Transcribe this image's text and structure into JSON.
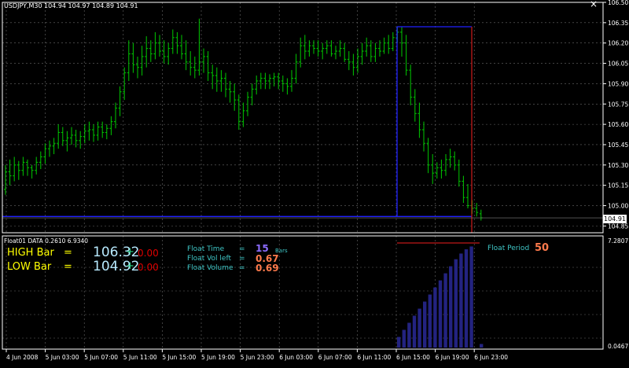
{
  "chart_title": "USDJPY,M30",
  "ohlc_readout": "104.94 104.97 104.89 104.91",
  "current_price": "104.91",
  "colors": {
    "background": "#000000",
    "candle": "#00c800",
    "grid": "#6a6a6a",
    "axis_text": "#ffffff",
    "box": "#2020ff",
    "red_line": "#c01818",
    "histogram": "#232380",
    "label_cyan": "#3fc7c7",
    "value_orange": "#ff7a4c",
    "value_purple": "#8c6cff",
    "high_low_yellow": "#ffff00",
    "high_low_value": "#b8eaff",
    "red_value": "#e00000",
    "plus_green": "#2bd38a"
  },
  "price_axis": {
    "labels": [
      "106.50",
      "106.35",
      "106.20",
      "106.05",
      "105.90",
      "105.75",
      "105.60",
      "105.45",
      "105.30",
      "105.15",
      "105.00",
      "104.85"
    ]
  },
  "time_axis": {
    "labels": [
      "4 Jun 2008",
      "5 Jun 03:00",
      "5 Jun 07:00",
      "5 Jun 11:00",
      "5 Jun 15:00",
      "5 Jun 19:00",
      "5 Jun 23:00",
      "6 Jun 03:00",
      "6 Jun 07:00",
      "6 Jun 11:00",
      "6 Jun 15:00",
      "6 Jun 19:00",
      "6 Jun 23:00"
    ]
  },
  "indicator": {
    "title": "Float01 DATA 0.2610 6.9340",
    "axis_top": "7.2807",
    "axis_bottom": "0.0467",
    "high_label": "HIGH Bar",
    "high_eq": "=",
    "high_value": "106.32",
    "high_plus": "+",
    "high_delta": "0.00",
    "low_label": "LOW Bar",
    "low_eq": "=",
    "low_value": "104.92",
    "low_plus": "+",
    "low_delta": "0.00",
    "float_time_label": "Float Time",
    "float_time_eq": "=",
    "float_time_value": "15",
    "float_time_unit": "Bars",
    "float_vol_left_label": "Float Vol left",
    "float_vol_left_eq": "=",
    "float_vol_left_value": "0.67",
    "float_volume_label": "Float Volume",
    "float_volume_eq": "=",
    "float_volume_value": "0.69",
    "float_period_label": "Float Period",
    "float_period_value": "50"
  },
  "chart_data": {
    "type": "candlestick",
    "symbol": "USDJPY",
    "timeframe": "M30",
    "ylim": [
      104.8,
      106.5
    ],
    "box": {
      "high": 106.32,
      "low": 104.92
    },
    "candles": [
      {
        "o": 105.12,
        "h": 105.3,
        "l": 105.08,
        "c": 105.25
      },
      {
        "o": 105.25,
        "h": 105.34,
        "l": 105.15,
        "c": 105.22
      },
      {
        "o": 105.22,
        "h": 105.36,
        "l": 105.18,
        "c": 105.3
      },
      {
        "o": 105.3,
        "h": 105.33,
        "l": 105.19,
        "c": 105.26
      },
      {
        "o": 105.26,
        "h": 105.36,
        "l": 105.22,
        "c": 105.32
      },
      {
        "o": 105.32,
        "h": 105.34,
        "l": 105.22,
        "c": 105.28
      },
      {
        "o": 105.28,
        "h": 105.3,
        "l": 105.2,
        "c": 105.26
      },
      {
        "o": 105.26,
        "h": 105.36,
        "l": 105.23,
        "c": 105.32
      },
      {
        "o": 105.32,
        "h": 105.4,
        "l": 105.27,
        "c": 105.36
      },
      {
        "o": 105.36,
        "h": 105.46,
        "l": 105.31,
        "c": 105.42
      },
      {
        "o": 105.42,
        "h": 105.48,
        "l": 105.36,
        "c": 105.44
      },
      {
        "o": 105.44,
        "h": 105.5,
        "l": 105.38,
        "c": 105.46
      },
      {
        "o": 105.46,
        "h": 105.6,
        "l": 105.42,
        "c": 105.54
      },
      {
        "o": 105.54,
        "h": 105.58,
        "l": 105.44,
        "c": 105.48
      },
      {
        "o": 105.48,
        "h": 105.55,
        "l": 105.4,
        "c": 105.5
      },
      {
        "o": 105.5,
        "h": 105.58,
        "l": 105.45,
        "c": 105.52
      },
      {
        "o": 105.52,
        "h": 105.56,
        "l": 105.43,
        "c": 105.48
      },
      {
        "o": 105.48,
        "h": 105.55,
        "l": 105.42,
        "c": 105.51
      },
      {
        "o": 105.51,
        "h": 105.6,
        "l": 105.46,
        "c": 105.55
      },
      {
        "o": 105.55,
        "h": 105.62,
        "l": 105.48,
        "c": 105.56
      },
      {
        "o": 105.56,
        "h": 105.6,
        "l": 105.47,
        "c": 105.52
      },
      {
        "o": 105.52,
        "h": 105.62,
        "l": 105.48,
        "c": 105.58
      },
      {
        "o": 105.58,
        "h": 105.62,
        "l": 105.5,
        "c": 105.54
      },
      {
        "o": 105.54,
        "h": 105.6,
        "l": 105.49,
        "c": 105.57
      },
      {
        "o": 105.57,
        "h": 105.66,
        "l": 105.52,
        "c": 105.62
      },
      {
        "o": 105.62,
        "h": 105.76,
        "l": 105.57,
        "c": 105.72
      },
      {
        "o": 105.72,
        "h": 105.88,
        "l": 105.66,
        "c": 105.84
      },
      {
        "o": 105.84,
        "h": 106.02,
        "l": 105.78,
        "c": 105.98
      },
      {
        "o": 105.98,
        "h": 106.22,
        "l": 105.92,
        "c": 106.12
      },
      {
        "o": 106.12,
        "h": 106.2,
        "l": 105.98,
        "c": 106.04
      },
      {
        "o": 106.04,
        "h": 106.1,
        "l": 105.94,
        "c": 106.02
      },
      {
        "o": 106.02,
        "h": 106.18,
        "l": 105.96,
        "c": 106.1
      },
      {
        "o": 106.1,
        "h": 106.25,
        "l": 106.02,
        "c": 106.16
      },
      {
        "o": 106.16,
        "h": 106.22,
        "l": 106.06,
        "c": 106.12
      },
      {
        "o": 106.12,
        "h": 106.28,
        "l": 106.08,
        "c": 106.2
      },
      {
        "o": 106.2,
        "h": 106.26,
        "l": 106.1,
        "c": 106.14
      },
      {
        "o": 106.14,
        "h": 106.22,
        "l": 106.05,
        "c": 106.1
      },
      {
        "o": 106.1,
        "h": 106.2,
        "l": 106.04,
        "c": 106.16
      },
      {
        "o": 106.16,
        "h": 106.3,
        "l": 106.12,
        "c": 106.24
      },
      {
        "o": 106.24,
        "h": 106.28,
        "l": 106.12,
        "c": 106.18
      },
      {
        "o": 106.18,
        "h": 106.26,
        "l": 106.08,
        "c": 106.12
      },
      {
        "o": 106.12,
        "h": 106.22,
        "l": 106.0,
        "c": 106.06
      },
      {
        "o": 106.06,
        "h": 106.14,
        "l": 105.96,
        "c": 106.02
      },
      {
        "o": 106.02,
        "h": 106.1,
        "l": 105.94,
        "c": 106.0
      },
      {
        "o": 106.0,
        "h": 106.38,
        "l": 105.96,
        "c": 106.06
      },
      {
        "o": 106.06,
        "h": 106.16,
        "l": 105.98,
        "c": 106.1
      },
      {
        "o": 106.1,
        "h": 106.14,
        "l": 105.92,
        "c": 105.98
      },
      {
        "o": 105.98,
        "h": 106.04,
        "l": 105.86,
        "c": 105.96
      },
      {
        "o": 105.96,
        "h": 106.02,
        "l": 105.84,
        "c": 105.92
      },
      {
        "o": 105.92,
        "h": 106.0,
        "l": 105.84,
        "c": 105.94
      },
      {
        "o": 105.94,
        "h": 105.98,
        "l": 105.8,
        "c": 105.86
      },
      {
        "o": 105.86,
        "h": 105.92,
        "l": 105.76,
        "c": 105.84
      },
      {
        "o": 105.84,
        "h": 105.9,
        "l": 105.7,
        "c": 105.78
      },
      {
        "o": 105.78,
        "h": 105.82,
        "l": 105.56,
        "c": 105.62
      },
      {
        "o": 105.62,
        "h": 105.76,
        "l": 105.58,
        "c": 105.7
      },
      {
        "o": 105.7,
        "h": 105.84,
        "l": 105.66,
        "c": 105.8
      },
      {
        "o": 105.8,
        "h": 105.9,
        "l": 105.74,
        "c": 105.86
      },
      {
        "o": 105.86,
        "h": 105.96,
        "l": 105.82,
        "c": 105.92
      },
      {
        "o": 105.92,
        "h": 105.98,
        "l": 105.86,
        "c": 105.94
      },
      {
        "o": 105.94,
        "h": 105.98,
        "l": 105.86,
        "c": 105.92
      },
      {
        "o": 105.92,
        "h": 105.97,
        "l": 105.86,
        "c": 105.94
      },
      {
        "o": 105.94,
        "h": 105.98,
        "l": 105.88,
        "c": 105.95
      },
      {
        "o": 105.95,
        "h": 105.98,
        "l": 105.86,
        "c": 105.92
      },
      {
        "o": 105.92,
        "h": 105.96,
        "l": 105.84,
        "c": 105.9
      },
      {
        "o": 105.9,
        "h": 105.94,
        "l": 105.82,
        "c": 105.88
      },
      {
        "o": 105.88,
        "h": 106.0,
        "l": 105.84,
        "c": 105.94
      },
      {
        "o": 105.94,
        "h": 106.12,
        "l": 105.9,
        "c": 106.06
      },
      {
        "o": 106.06,
        "h": 106.24,
        "l": 106.02,
        "c": 106.18
      },
      {
        "o": 106.18,
        "h": 106.26,
        "l": 106.08,
        "c": 106.14
      },
      {
        "o": 106.14,
        "h": 106.22,
        "l": 106.1,
        "c": 106.18
      },
      {
        "o": 106.18,
        "h": 106.22,
        "l": 106.12,
        "c": 106.16
      },
      {
        "o": 106.16,
        "h": 106.22,
        "l": 106.1,
        "c": 106.14
      },
      {
        "o": 106.14,
        "h": 106.2,
        "l": 106.08,
        "c": 106.16
      },
      {
        "o": 106.16,
        "h": 106.22,
        "l": 106.12,
        "c": 106.18
      },
      {
        "o": 106.18,
        "h": 106.22,
        "l": 106.1,
        "c": 106.12
      },
      {
        "o": 106.12,
        "h": 106.18,
        "l": 106.08,
        "c": 106.14
      },
      {
        "o": 106.14,
        "h": 106.22,
        "l": 106.1,
        "c": 106.16
      },
      {
        "o": 106.16,
        "h": 106.2,
        "l": 106.06,
        "c": 106.08
      },
      {
        "o": 106.08,
        "h": 106.14,
        "l": 106.0,
        "c": 106.06
      },
      {
        "o": 106.06,
        "h": 106.12,
        "l": 105.96,
        "c": 106.02
      },
      {
        "o": 106.02,
        "h": 106.16,
        "l": 105.98,
        "c": 106.1
      },
      {
        "o": 106.1,
        "h": 106.2,
        "l": 106.04,
        "c": 106.14
      },
      {
        "o": 106.14,
        "h": 106.24,
        "l": 106.1,
        "c": 106.18
      },
      {
        "o": 106.18,
        "h": 106.22,
        "l": 106.06,
        "c": 106.1
      },
      {
        "o": 106.1,
        "h": 106.2,
        "l": 106.06,
        "c": 106.16
      },
      {
        "o": 106.16,
        "h": 106.22,
        "l": 106.1,
        "c": 106.14
      },
      {
        "o": 106.14,
        "h": 106.24,
        "l": 106.12,
        "c": 106.2
      },
      {
        "o": 106.2,
        "h": 106.26,
        "l": 106.12,
        "c": 106.16
      },
      {
        "o": 106.16,
        "h": 106.28,
        "l": 106.14,
        "c": 106.24
      },
      {
        "o": 106.24,
        "h": 106.32,
        "l": 106.2,
        "c": 106.28
      },
      {
        "o": 106.28,
        "h": 106.32,
        "l": 106.1,
        "c": 106.2
      },
      {
        "o": 106.2,
        "h": 106.26,
        "l": 105.96,
        "c": 106.0
      },
      {
        "o": 106.0,
        "h": 106.04,
        "l": 105.74,
        "c": 105.8
      },
      {
        "o": 105.8,
        "h": 105.86,
        "l": 105.62,
        "c": 105.68
      },
      {
        "o": 105.68,
        "h": 105.76,
        "l": 105.5,
        "c": 105.56
      },
      {
        "o": 105.56,
        "h": 105.62,
        "l": 105.4,
        "c": 105.46
      },
      {
        "o": 105.46,
        "h": 105.5,
        "l": 105.24,
        "c": 105.3
      },
      {
        "o": 105.3,
        "h": 105.38,
        "l": 105.16,
        "c": 105.24
      },
      {
        "o": 105.24,
        "h": 105.32,
        "l": 105.2,
        "c": 105.28
      },
      {
        "o": 105.28,
        "h": 105.34,
        "l": 105.2,
        "c": 105.26
      },
      {
        "o": 105.26,
        "h": 105.38,
        "l": 105.22,
        "c": 105.34
      },
      {
        "o": 105.34,
        "h": 105.42,
        "l": 105.28,
        "c": 105.36
      },
      {
        "o": 105.36,
        "h": 105.4,
        "l": 105.26,
        "c": 105.3
      },
      {
        "o": 105.3,
        "h": 105.34,
        "l": 105.14,
        "c": 105.18
      },
      {
        "o": 105.18,
        "h": 105.22,
        "l": 105.02,
        "c": 105.06
      },
      {
        "o": 105.06,
        "h": 105.16,
        "l": 104.98,
        "c": 105.0
      },
      {
        "o": 105.0,
        "h": 105.04,
        "l": 104.94,
        "c": 104.98
      },
      {
        "o": 104.98,
        "h": 105.02,
        "l": 104.92,
        "c": 104.95
      },
      {
        "o": 104.94,
        "h": 104.97,
        "l": 104.89,
        "c": 104.91
      }
    ],
    "histogram": [
      0.8,
      1.3,
      1.8,
      2.3,
      2.8,
      3.3,
      3.8,
      4.3,
      4.8,
      5.3,
      5.8,
      6.3,
      6.7,
      7.0,
      7.2,
      0.3
    ]
  }
}
